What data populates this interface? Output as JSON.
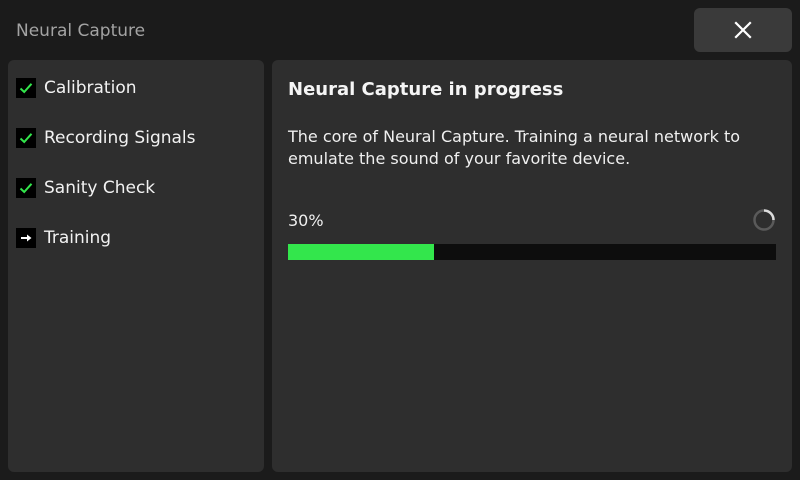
{
  "window": {
    "title": "Neural Capture",
    "close_icon": "close-icon"
  },
  "sidebar": {
    "steps": [
      {
        "label": "Calibration",
        "status": "done",
        "icon": "check-icon"
      },
      {
        "label": "Recording Signals",
        "status": "done",
        "icon": "check-icon"
      },
      {
        "label": "Sanity Check",
        "status": "done",
        "icon": "check-icon"
      },
      {
        "label": "Training",
        "status": "current",
        "icon": "arrow-right-icon"
      }
    ]
  },
  "main": {
    "heading": "Neural Capture in progress",
    "description": "The core of Neural Capture. Training a neural network to emulate the sound of your favorite device.",
    "progress_text": "30%",
    "progress_value": 0.3,
    "spinner_icon": "loading-spinner-icon"
  },
  "colors": {
    "accent": "#33e64c",
    "panel": "#2e2e2e",
    "background": "#1b1b1b"
  }
}
